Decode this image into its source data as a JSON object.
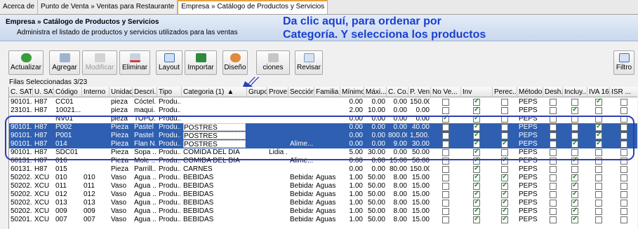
{
  "tabs": [
    "Acerca de",
    "Punto de Venta » Ventas para Restaurante",
    "Empresa » Catálogo de Productos y Servicios"
  ],
  "header": {
    "title": "Empresa » Catálogo de Productos y Servicios",
    "subtitle": "Administra el listado de productos y servicios utilizados para las ventas"
  },
  "annotation": {
    "line1": "Da clic aquí, para ordenar por",
    "line2": "Categoría. Y selecciona los productos"
  },
  "toolbar": {
    "actualizar": "Actualizar",
    "agregar": "Agregar",
    "modificar": "Modificar",
    "eliminar": "Eliminar",
    "layout": "Layout",
    "importar": "Importar",
    "diseno": "Diseño",
    "acciones": "ciones",
    "revisar": "Revisar",
    "filtro": "Filtro"
  },
  "filas": "Filas Seleccionadas  3/23",
  "columns": [
    "C. SAT",
    "U. SAT",
    "Código",
    "Interno",
    "Unidad",
    "Descri...",
    "Tipo",
    "Categoria (1)",
    "Grupo",
    "Prove...",
    "Sección",
    "Familia",
    "Mínimo",
    "Máxi...",
    "C. Co...",
    "P. Ven...",
    "No Ve...",
    "Inv",
    "Perec...",
    "Método",
    "Desh...",
    "Incluy...",
    "IVA 16",
    "ISR ..."
  ],
  "rows": [
    {
      "csat": "90101...",
      "usat": "H87",
      "codigo": "CC01",
      "interno": "",
      "unidad": "pieza",
      "desc": "Cóctel...",
      "tipo": "Produ...",
      "cat": "",
      "grupo": "",
      "prov": "",
      "secc": "",
      "fam": "",
      "min": "0.00",
      "max": "0.00",
      "cco": "0.00",
      "pven": "150.00",
      "nov": false,
      "inv": true,
      "per": false,
      "met": "PEPS",
      "desh": false,
      "incl": false,
      "iva": true,
      "isr": false,
      "sel": false
    },
    {
      "csat": "23101...",
      "usat": "H87",
      "codigo": "10021...",
      "interno": "",
      "unidad": "pieza",
      "desc": "maqui...",
      "tipo": "Produ...",
      "cat": "",
      "grupo": "",
      "prov": "",
      "secc": "",
      "fam": "",
      "min": "2.00",
      "max": "10.00",
      "cco": "0.00",
      "pven": "0.00",
      "nov": false,
      "inv": true,
      "per": false,
      "met": "PEPS",
      "desh": false,
      "incl": true,
      "iva": false,
      "isr": false,
      "sel": false
    },
    {
      "csat": "",
      "usat": "",
      "codigo": "NV01",
      "interno": "",
      "unidad": "pieza",
      "desc": "TOPO...",
      "tipo": "Produ...",
      "cat": "",
      "grupo": "",
      "prov": "",
      "secc": "",
      "fam": "",
      "min": "0.00",
      "max": "0.00",
      "cco": "0.00",
      "pven": "0.00",
      "nov": true,
      "inv": true,
      "per": false,
      "met": "PEPS",
      "desh": false,
      "incl": false,
      "iva": false,
      "isr": false,
      "sel": false
    },
    {
      "csat": "90101...",
      "usat": "H87",
      "codigo": "P002",
      "interno": "",
      "unidad": "Pieza",
      "desc": "Pastel ...",
      "tipo": "Produ...",
      "cat": "POSTRES",
      "grupo": "",
      "prov": "",
      "secc": "",
      "fam": "",
      "min": "0.00",
      "max": "0.00",
      "cco": "0.00",
      "pven": "40.00",
      "nov": false,
      "inv": true,
      "per": false,
      "met": "PEPS",
      "desh": false,
      "incl": false,
      "iva": true,
      "isr": false,
      "sel": true
    },
    {
      "csat": "90101...",
      "usat": "H87",
      "codigo": "P001",
      "interno": "",
      "unidad": "Pieza",
      "desc": "Pastel ...",
      "tipo": "Produ...",
      "cat": "POSTRES",
      "grupo": "",
      "prov": "",
      "secc": "",
      "fam": "",
      "min": "0.00",
      "max": "0.00",
      "cco": "800.00",
      "pven": "1,500...",
      "nov": false,
      "inv": true,
      "per": false,
      "met": "PEPS",
      "desh": false,
      "incl": false,
      "iva": true,
      "isr": false,
      "sel": true
    },
    {
      "csat": "90101...",
      "usat": "H87",
      "codigo": "014",
      "interno": "",
      "unidad": "Pieza",
      "desc": "Flan N...",
      "tipo": "Produ...",
      "cat": "POSTRES",
      "grupo": "",
      "prov": "",
      "secc": "Alime...",
      "fam": "",
      "min": "0.00",
      "max": "0.00",
      "cco": "9.00",
      "pven": "30.00",
      "nov": false,
      "inv": true,
      "per": true,
      "met": "PEPS",
      "desh": false,
      "incl": true,
      "iva": true,
      "isr": false,
      "sel": true
    },
    {
      "csat": "90101...",
      "usat": "H87",
      "codigo": "SDC01",
      "interno": "",
      "unidad": "Pieza",
      "desc": "Sopa ...",
      "tipo": "Produ...",
      "cat": "COMIDA DEL DIA",
      "grupo": "",
      "prov": "Lidia ...",
      "secc": "",
      "fam": "",
      "min": "5.00",
      "max": "30.00",
      "cco": "0.00",
      "pven": "50.00",
      "nov": false,
      "inv": true,
      "per": false,
      "met": "PEPS",
      "desh": false,
      "incl": false,
      "iva": false,
      "isr": false,
      "sel": false
    },
    {
      "csat": "60131...",
      "usat": "H87",
      "codigo": "016",
      "interno": "",
      "unidad": "Pieza",
      "desc": "Mole ...",
      "tipo": "Produ...",
      "cat": "COMIDA DEL DIA",
      "grupo": "",
      "prov": "",
      "secc": "Alime...",
      "fam": "",
      "min": "0.00",
      "max": "0.00",
      "cco": "15.00",
      "pven": "50.00",
      "nov": false,
      "inv": true,
      "per": true,
      "met": "PEPS",
      "desh": false,
      "incl": true,
      "iva": false,
      "isr": false,
      "sel": false
    },
    {
      "csat": "60131...",
      "usat": "H87",
      "codigo": "015",
      "interno": "",
      "unidad": "Pieza",
      "desc": "Parrill...",
      "tipo": "Produ...",
      "cat": "CARNES",
      "grupo": "",
      "prov": "",
      "secc": "",
      "fam": "",
      "min": "0.00",
      "max": "0.00",
      "cco": "80.00",
      "pven": "150.00",
      "nov": false,
      "inv": true,
      "per": false,
      "met": "PEPS",
      "desh": false,
      "incl": false,
      "iva": false,
      "isr": false,
      "sel": false
    },
    {
      "csat": "50202...",
      "usat": "XCU",
      "codigo": "010",
      "interno": "010",
      "unidad": "Vaso",
      "desc": "Agua ...",
      "tipo": "Produ...",
      "cat": "BEBIDAS",
      "grupo": "",
      "prov": "",
      "secc": "Bebidas",
      "fam": "Aguas",
      "min": "1.00",
      "max": "50.00",
      "cco": "8.00",
      "pven": "15.00",
      "nov": false,
      "inv": true,
      "per": true,
      "met": "PEPS",
      "desh": false,
      "incl": true,
      "iva": false,
      "isr": false,
      "sel": false
    },
    {
      "csat": "50202...",
      "usat": "XCU",
      "codigo": "011",
      "interno": "011",
      "unidad": "Vaso",
      "desc": "Agua ...",
      "tipo": "Produ...",
      "cat": "BEBIDAS",
      "grupo": "",
      "prov": "",
      "secc": "Bebidas",
      "fam": "Aguas",
      "min": "1.00",
      "max": "50.00",
      "cco": "8.00",
      "pven": "15.00",
      "nov": false,
      "inv": true,
      "per": true,
      "met": "PEPS",
      "desh": false,
      "incl": true,
      "iva": false,
      "isr": false,
      "sel": false
    },
    {
      "csat": "50202...",
      "usat": "XCU",
      "codigo": "012",
      "interno": "012",
      "unidad": "Vaso",
      "desc": "Agua ...",
      "tipo": "Produ...",
      "cat": "BEBIDAS",
      "grupo": "",
      "prov": "",
      "secc": "Bebidas",
      "fam": "Aguas",
      "min": "1.00",
      "max": "50.00",
      "cco": "8.00",
      "pven": "15.00",
      "nov": false,
      "inv": true,
      "per": true,
      "met": "PEPS",
      "desh": false,
      "incl": true,
      "iva": false,
      "isr": false,
      "sel": false
    },
    {
      "csat": "50202...",
      "usat": "XCU",
      "codigo": "013",
      "interno": "013",
      "unidad": "Vaso",
      "desc": "Agua ...",
      "tipo": "Produ...",
      "cat": "BEBIDAS",
      "grupo": "",
      "prov": "",
      "secc": "Bebidas",
      "fam": "Aguas",
      "min": "1.00",
      "max": "50.00",
      "cco": "8.00",
      "pven": "15.00",
      "nov": false,
      "inv": true,
      "per": true,
      "met": "PEPS",
      "desh": false,
      "incl": true,
      "iva": false,
      "isr": false,
      "sel": false
    },
    {
      "csat": "50202...",
      "usat": "XCU",
      "codigo": "009",
      "interno": "009",
      "unidad": "Vaso",
      "desc": "Agua ...",
      "tipo": "Produ...",
      "cat": "BEBIDAS",
      "grupo": "",
      "prov": "",
      "secc": "Bebidas",
      "fam": "Aguas",
      "min": "1.00",
      "max": "50.00",
      "cco": "8.00",
      "pven": "15.00",
      "nov": false,
      "inv": true,
      "per": true,
      "met": "PEPS",
      "desh": false,
      "incl": true,
      "iva": false,
      "isr": false,
      "sel": false
    },
    {
      "csat": "50201...",
      "usat": "XCU",
      "codigo": "007",
      "interno": "007",
      "unidad": "Vaso",
      "desc": "Agua ...",
      "tipo": "Produ...",
      "cat": "BEBIDAS",
      "grupo": "",
      "prov": "",
      "secc": "Bebidas",
      "fam": "Aguas",
      "min": "1.00",
      "max": "50.00",
      "cco": "8.00",
      "pven": "15.00",
      "nov": false,
      "inv": true,
      "per": true,
      "met": "PEPS",
      "desh": false,
      "incl": true,
      "iva": false,
      "isr": false,
      "sel": false
    }
  ]
}
